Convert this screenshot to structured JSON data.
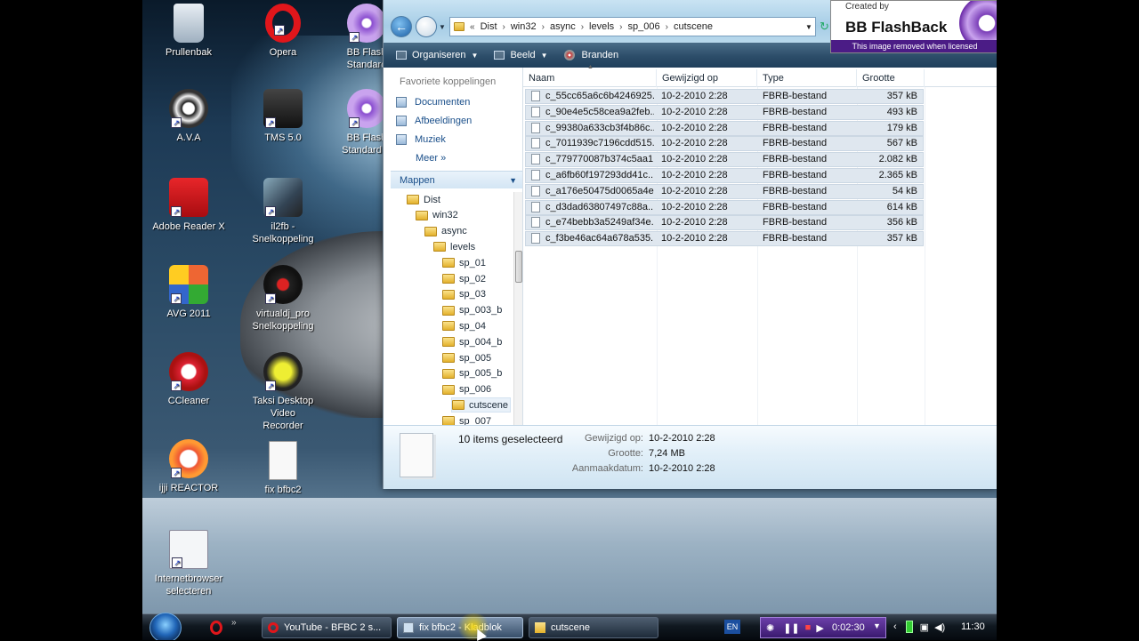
{
  "desktop": {
    "icons": [
      {
        "label": "Prullenbak",
        "icon": "recycle-bin-icon"
      },
      {
        "label": "Opera",
        "icon": "opera-icon"
      },
      {
        "label": "BB Flash",
        "label2": "Standard",
        "icon": "bb-flashback-icon"
      },
      {
        "label": "A.V.A",
        "icon": "ava-game-icon"
      },
      {
        "label": "TMS 5.0",
        "icon": "tms-train-icon"
      },
      {
        "label": "BB Flash",
        "label2": "Standard R",
        "icon": "bb-flashback-icon"
      },
      {
        "label": "Adobe Reader X",
        "icon": "adobe-reader-icon"
      },
      {
        "label": "il2fb - Snelkoppeling",
        "icon": "il2fb-plane-icon"
      },
      {
        "label": "AVG 2011",
        "icon": "avg-antivirus-icon"
      },
      {
        "label": "virtualdj_pro",
        "label2": "Snelkoppeling",
        "icon": "virtualdj-icon"
      },
      {
        "label": "CCleaner",
        "icon": "ccleaner-icon"
      },
      {
        "label": "Taksi Desktop Video",
        "label2": "Recorder",
        "icon": "taksi-recorder-icon"
      },
      {
        "label": "ijji REACTOR",
        "icon": "ijji-reactor-icon"
      },
      {
        "label": "fix bfbc2",
        "icon": "text-file-icon"
      },
      {
        "label": "Internetbrowser",
        "label2": "selecteren",
        "icon": "browser-select-icon"
      }
    ]
  },
  "explorer": {
    "address": {
      "prefix": "«",
      "crumbs": [
        "Dist",
        "win32",
        "async",
        "levels",
        "sp_006",
        "cutscene"
      ]
    },
    "toolbar": {
      "organize": "Organiseren",
      "view": "Beeld",
      "burn": "Branden"
    },
    "nav": {
      "favorites_title": "Favoriete koppelingen",
      "favorites": [
        "Documenten",
        "Afbeeldingen",
        "Muziek"
      ],
      "more": "Meer",
      "folders_title": "Mappen",
      "tree": [
        {
          "label": "Dist",
          "level": 0
        },
        {
          "label": "win32",
          "level": 1
        },
        {
          "label": "async",
          "level": 2
        },
        {
          "label": "levels",
          "level": 3
        },
        {
          "label": "sp_01",
          "level": 4
        },
        {
          "label": "sp_02",
          "level": 4
        },
        {
          "label": "sp_03",
          "level": 4
        },
        {
          "label": "sp_003_b",
          "level": 4
        },
        {
          "label": "sp_04",
          "level": 4
        },
        {
          "label": "sp_004_b",
          "level": 4
        },
        {
          "label": "sp_005",
          "level": 4
        },
        {
          "label": "sp_005_b",
          "level": 4
        },
        {
          "label": "sp_006",
          "level": 4
        },
        {
          "label": "cutscene",
          "level": 5,
          "selected": true
        },
        {
          "label": "sp_007",
          "level": 4
        }
      ]
    },
    "columns": {
      "name": "Naam",
      "modified": "Gewijzigd op",
      "type": "Type",
      "size": "Grootte"
    },
    "files": [
      {
        "name": "c_55cc65a6c6b4246925...",
        "modified": "10-2-2010 2:28",
        "type": "FBRB-bestand",
        "size": "357 kB"
      },
      {
        "name": "c_90e4e5c58cea9a2feb...",
        "modified": "10-2-2010 2:28",
        "type": "FBRB-bestand",
        "size": "493 kB"
      },
      {
        "name": "c_99380a633cb3f4b86c...",
        "modified": "10-2-2010 2:28",
        "type": "FBRB-bestand",
        "size": "179 kB"
      },
      {
        "name": "c_7011939c7196cdd515...",
        "modified": "10-2-2010 2:28",
        "type": "FBRB-bestand",
        "size": "567 kB"
      },
      {
        "name": "c_779770087b374c5aa1...",
        "modified": "10-2-2010 2:28",
        "type": "FBRB-bestand",
        "size": "2.082 kB"
      },
      {
        "name": "c_a6fb60f197293dd41c...",
        "modified": "10-2-2010 2:28",
        "type": "FBRB-bestand",
        "size": "2.365 kB"
      },
      {
        "name": "c_a176e50475d0065a4e...",
        "modified": "10-2-2010 2:28",
        "type": "FBRB-bestand",
        "size": "54 kB"
      },
      {
        "name": "c_d3dad63807497c88a...",
        "modified": "10-2-2010 2:28",
        "type": "FBRB-bestand",
        "size": "614 kB"
      },
      {
        "name": "c_e74bebb3a5249af34e...",
        "modified": "10-2-2010 2:28",
        "type": "FBRB-bestand",
        "size": "356 kB"
      },
      {
        "name": "c_f3be46ac64a678a535...",
        "modified": "10-2-2010 2:28",
        "type": "FBRB-bestand",
        "size": "357 kB"
      }
    ],
    "details": {
      "count": "10 items geselecteerd",
      "modified_label": "Gewijzigd op:",
      "modified": "10-2-2010 2:28",
      "size_label": "Grootte:",
      "size": "7,24 MB",
      "created_label": "Aanmaakdatum:",
      "created": "10-2-2010 2:28"
    }
  },
  "watermark": {
    "created_by": "Created by",
    "brand": "BB FlashBack",
    "note": "This image removed when licensed"
  },
  "taskbar": {
    "tasks": [
      {
        "label": "YouTube - BFBC 2 s...",
        "icon": "opera-icon"
      },
      {
        "label": "fix bfbc2 - Kladblok",
        "icon": "notepad-icon",
        "active": true
      },
      {
        "label": "cutscene",
        "icon": "folder-icon"
      }
    ],
    "language": "EN",
    "recording_time": "0:02:30",
    "clock": "11:30"
  },
  "colors": {
    "accent": "#1a4f8a",
    "toolbar": "#2c4d69",
    "selection": "#dfe7ef"
  }
}
